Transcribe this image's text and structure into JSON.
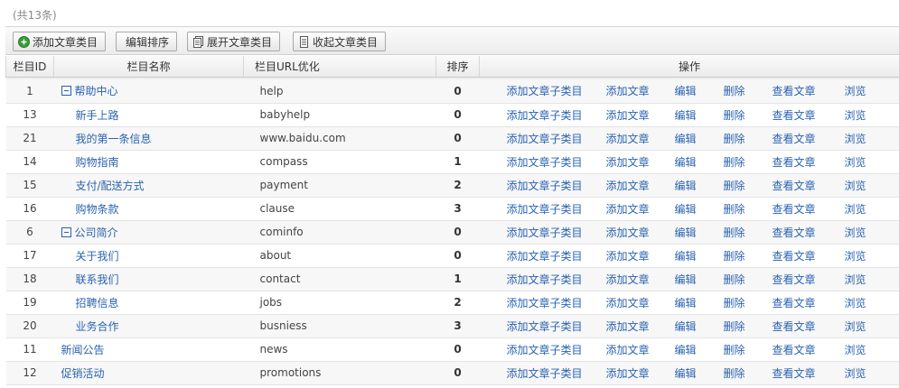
{
  "count_text": "(共13条)",
  "toolbar": {
    "add_category": "添加文章类目",
    "edit_sort": "编辑排序",
    "expand": "展开文章类目",
    "collapse": "收起文章类目"
  },
  "columns": {
    "id": "栏目ID",
    "name": "栏目名称",
    "url": "栏目URL优化",
    "sort": "排序",
    "ops": "操作"
  },
  "actions": [
    "添加文章子类目",
    "添加文章",
    "编辑",
    "删除",
    "查看文章",
    "浏览"
  ],
  "rows": [
    {
      "id": "1",
      "name": "帮助中心",
      "url": "help",
      "sort": "0",
      "level": 0,
      "expanded": true
    },
    {
      "id": "13",
      "name": "新手上路",
      "url": "babyhelp",
      "sort": "0",
      "level": 1
    },
    {
      "id": "21",
      "name": "我的第一条信息",
      "url": "www.baidu.com",
      "sort": "0",
      "level": 1
    },
    {
      "id": "14",
      "name": "购物指南",
      "url": "compass",
      "sort": "1",
      "level": 1
    },
    {
      "id": "15",
      "name": "支付/配送方式",
      "url": "payment",
      "sort": "2",
      "level": 1
    },
    {
      "id": "16",
      "name": "购物条款",
      "url": "clause",
      "sort": "3",
      "level": 1
    },
    {
      "id": "6",
      "name": "公司简介",
      "url": "cominfo",
      "sort": "0",
      "level": 0,
      "expanded": true
    },
    {
      "id": "17",
      "name": "关于我们",
      "url": "about",
      "sort": "0",
      "level": 1
    },
    {
      "id": "18",
      "name": "联系我们",
      "url": "contact",
      "sort": "1",
      "level": 1
    },
    {
      "id": "19",
      "name": "招聘信息",
      "url": "jobs",
      "sort": "2",
      "level": 1
    },
    {
      "id": "20",
      "name": "业务合作",
      "url": "busniess",
      "sort": "3",
      "level": 1
    },
    {
      "id": "11",
      "name": "新闻公告",
      "url": "news",
      "sort": "0",
      "level": 0
    },
    {
      "id": "12",
      "name": "促销活动",
      "url": "promotions",
      "sort": "0",
      "level": 0
    }
  ],
  "colors": {
    "link": "#2a63b1",
    "add_icon": "#3a9a3a"
  },
  "icons": {
    "add": "add-circle-icon",
    "expand": "expand-docs-icon",
    "collapse": "collapse-doc-icon",
    "tree_toggle": "minus-box-icon"
  }
}
